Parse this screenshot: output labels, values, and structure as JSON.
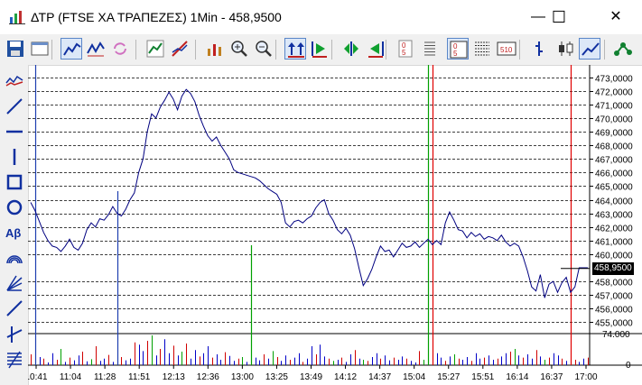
{
  "window": {
    "title": "ΔΤΡ (FTSE ΧΑ ΤΡΑΠΕΖΕΣ) 1Min - 458,9500",
    "minimize_label": "—",
    "maximize_label": "☐",
    "close_label": "✕"
  },
  "toolbar": {
    "buttons": [
      {
        "name": "save",
        "icon": "floppy-disk-icon",
        "active": false
      },
      {
        "name": "view",
        "icon": "window-icon",
        "active": false
      },
      {
        "name": "line-chart",
        "icon": "line-chart-icon",
        "active": true
      },
      {
        "name": "compare",
        "icon": "compare-chart-icon",
        "active": false
      },
      {
        "name": "refresh",
        "icon": "refresh-icon",
        "active": false
      },
      {
        "name": "indicator",
        "icon": "indicator-chart-icon",
        "active": false
      },
      {
        "name": "trend",
        "icon": "trend-tool-icon",
        "active": false
      },
      {
        "name": "studies",
        "icon": "studies-icon",
        "active": false
      },
      {
        "name": "zoom-in",
        "icon": "zoom-in-icon",
        "active": false
      },
      {
        "name": "zoom-out",
        "icon": "zoom-out-icon",
        "active": false
      },
      {
        "name": "fit",
        "icon": "fit-arrows-icon",
        "active": true
      },
      {
        "name": "go-start",
        "icon": "green-arrow-start-icon",
        "active": false
      },
      {
        "name": "go-middle",
        "icon": "green-arrows-icon",
        "active": false
      },
      {
        "name": "go-end",
        "icon": "green-arrow-end-icon",
        "active": false
      },
      {
        "name": "digits",
        "icon": "digits-icon",
        "active": false
      },
      {
        "name": "grid",
        "icon": "grid-icon",
        "active": false
      },
      {
        "name": "levels",
        "icon": "levels-icon",
        "active": true
      },
      {
        "name": "depth",
        "icon": "depth-icon",
        "active": false
      },
      {
        "name": "scale",
        "icon": "scale-icon",
        "active": false
      },
      {
        "name": "bar-mode",
        "icon": "bar-mode-icon",
        "active": false
      },
      {
        "name": "candle-mode",
        "icon": "candle-mode-icon",
        "active": false
      },
      {
        "name": "line-mode",
        "icon": "line-mode-icon",
        "active": true
      },
      {
        "name": "network",
        "icon": "network-icon",
        "active": false
      }
    ]
  },
  "tools": [
    {
      "name": "chart-type",
      "icon": "chart-type-icon"
    },
    {
      "name": "diagonal-line",
      "icon": "diagonal-line-icon"
    },
    {
      "name": "horizontal-line",
      "icon": "horizontal-line-icon"
    },
    {
      "name": "vertical-line",
      "icon": "vertical-line-icon"
    },
    {
      "name": "rectangle",
      "icon": "rectangle-icon"
    },
    {
      "name": "ellipse",
      "icon": "ellipse-icon"
    },
    {
      "name": "text",
      "icon": "text-tool-icon",
      "label": "Aβ"
    },
    {
      "name": "arc",
      "icon": "arc-icon"
    },
    {
      "name": "fan",
      "icon": "fan-icon"
    },
    {
      "name": "ray",
      "icon": "ray-icon"
    },
    {
      "name": "cross",
      "icon": "cross-line-icon"
    },
    {
      "name": "fibonacci",
      "icon": "fibonacci-icon"
    }
  ],
  "colors": {
    "price_line": "#000080",
    "volume_up": "#0000c8",
    "volume_down": "#d00000",
    "volume_neutral": "#00a000",
    "marker_green": "#00a000",
    "marker_red": "#e00000",
    "marker_blue": "#1f3fb0",
    "grid": "#000000"
  },
  "price_label": "458,9500",
  "chart_data": {
    "type": "line",
    "ylabels": [
      "473,0000",
      "472,0000",
      "471,0000",
      "470,0000",
      "469,0000",
      "468,0000",
      "467,0000",
      "466,0000",
      "465,0000",
      "464,0000",
      "463,0000",
      "462,0000",
      "461,0000",
      "460,0000",
      "458,0000",
      "457,0000",
      "456,0000",
      "455,0000"
    ],
    "ylim": [
      454.5,
      473.5
    ],
    "volume_labels": [
      "74.000",
      "0"
    ],
    "xlabels": [
      "10:41",
      "11:04",
      "11:28",
      "11:51",
      "12:13",
      "12:36",
      "13:00",
      "13:25",
      "13:49",
      "14:12",
      "14:37",
      "15:04",
      "15:27",
      "15:51",
      "16:14",
      "16:37",
      "17:00"
    ],
    "price_series": [
      463.8,
      463.2,
      462.4,
      461.6,
      461.0,
      460.6,
      460.5,
      460.2,
      460.6,
      461.1,
      460.5,
      460.3,
      460.8,
      461.8,
      462.3,
      462.0,
      462.6,
      462.5,
      462.9,
      463.5,
      463.0,
      462.8,
      463.3,
      464.0,
      464.5,
      466.0,
      467.0,
      469.0,
      470.3,
      470.0,
      470.8,
      471.3,
      471.9,
      471.4,
      470.6,
      471.6,
      472.1,
      471.8,
      471.2,
      470.2,
      469.4,
      468.7,
      468.3,
      468.6,
      468.0,
      467.5,
      467.0,
      466.2,
      466.0,
      465.9,
      465.8,
      465.7,
      465.6,
      465.4,
      465.1,
      464.8,
      464.6,
      464.4,
      463.8,
      462.3,
      462.0,
      462.4,
      462.5,
      462.3,
      462.6,
      462.8,
      463.4,
      463.8,
      464.0,
      463.0,
      462.5,
      461.8,
      461.5,
      461.9,
      461.4,
      460.4,
      459.0,
      457.7,
      458.2,
      458.9,
      459.8,
      460.6,
      460.2,
      460.3,
      459.8,
      460.3,
      460.8,
      460.5,
      460.6,
      460.9,
      460.5,
      460.8,
      461.1,
      460.7,
      461.0,
      460.7,
      462.3,
      463.1,
      462.5,
      461.8,
      461.7,
      461.2,
      461.6,
      461.3,
      461.5,
      461.1,
      461.3,
      461.2,
      461.0,
      461.4,
      460.9,
      460.6,
      460.8,
      460.6,
      459.8,
      458.8,
      457.6,
      457.3,
      458.5,
      456.8,
      457.8,
      458.0,
      457.2,
      457.9,
      458.3,
      457.2,
      457.6,
      459.0,
      459.0,
      459.0
    ],
    "volumes": [
      20,
      8,
      15,
      12,
      5,
      22,
      10,
      30,
      6,
      14,
      9,
      18,
      25,
      7,
      11,
      35,
      8,
      12,
      19,
      6,
      28,
      15,
      9,
      12,
      42,
      38,
      26,
      45,
      55,
      18,
      30,
      48,
      22,
      36,
      18,
      25,
      40,
      12,
      28,
      16,
      22,
      35,
      14,
      20,
      10,
      24,
      17,
      8,
      12,
      15,
      6,
      10,
      14,
      9,
      20,
      12,
      26,
      15,
      8,
      18,
      10,
      14,
      22,
      6,
      12,
      35,
      20,
      38,
      16,
      12,
      8,
      10,
      14,
      6,
      20,
      28,
      12,
      10,
      8,
      15,
      22,
      12,
      18,
      9,
      14,
      10,
      16,
      12,
      8,
      5,
      26,
      10,
      12,
      18,
      22,
      14,
      8,
      16,
      20,
      12,
      10,
      15,
      8,
      22,
      12,
      14,
      18,
      10,
      12,
      16,
      22,
      25,
      30,
      18,
      14,
      20,
      12,
      28,
      16,
      10,
      14,
      22,
      18,
      12,
      8,
      14,
      10,
      6,
      12,
      14
    ],
    "markers": [
      {
        "x_index": 2,
        "color": "blue",
        "volume_only": false
      },
      {
        "x_index": 24,
        "color": "blue",
        "volume_only": false
      },
      {
        "x_index": 59,
        "color": "green",
        "volume_only": true
      },
      {
        "x_index": 107,
        "color": "green",
        "volume_only": false
      },
      {
        "x_index": 108,
        "color": "red",
        "volume_only": false
      },
      {
        "x_index": 145,
        "color": "red",
        "volume_only": false
      }
    ]
  }
}
